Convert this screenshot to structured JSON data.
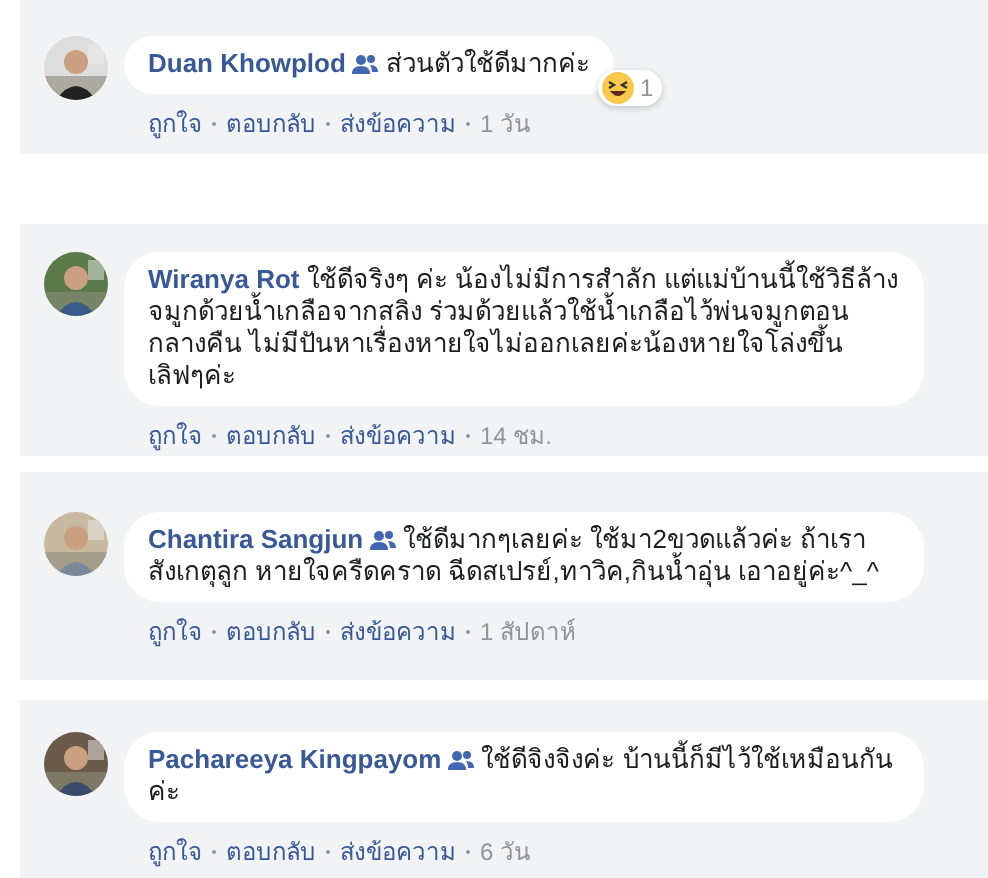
{
  "comments": [
    {
      "author": "Duan Khowplod",
      "friend": true,
      "text": "ส่วนตัวใช้ดีมากค่ะ",
      "reaction": {
        "count": "1"
      },
      "actions": [
        "ถูกใจ",
        "ตอบกลับ",
        "ส่งข้อความ"
      ],
      "time": "1 วัน"
    },
    {
      "author": "Wiranya Rot",
      "friend": false,
      "text": "ใช้ดีจริงๆ ค่ะ น้องไม่มีการสำลัก แต่แม่บ้านนี้ใช้วิธีล้างจมูกด้วยน้ำเกลือจากสลิง ร่วมด้วยแล้วใช้น้ำเกลือไว้พ่นจมูกตอนกลางคืน ไม่มีปันหาเรื่องหายใจไม่ออกเลยค่ะน้องหายใจโล่งขึ้น เลิฟๆค่ะ",
      "actions": [
        "ถูกใจ",
        "ตอบกลับ",
        "ส่งข้อความ"
      ],
      "time": "14 ชม."
    },
    {
      "author": "Chantira Sangjun",
      "friend": true,
      "text": "ใช้ดีมากๆเลยค่ะ ใช้มา2ขวดแล้วค่ะ ถ้าเราสังเกตุลูก หายใจครืดคราด ฉีดสเปรย์,ทาวิค,กินน้ำอุ่น เอาอยู่ค่ะ^_^",
      "actions": [
        "ถูกใจ",
        "ตอบกลับ",
        "ส่งข้อความ"
      ],
      "time": "1 สัปดาห์"
    },
    {
      "author": "Pachareeya Kingpayom",
      "friend": true,
      "text": "ใช้ดีจิงจิงค่ะ บ้านนี้ก็มีไว้ใช้เหมือนกันค่ะ",
      "actions": [
        "ถูกใจ",
        "ตอบกลับ",
        "ส่งข้อความ"
      ],
      "time": "6 วัน"
    }
  ]
}
